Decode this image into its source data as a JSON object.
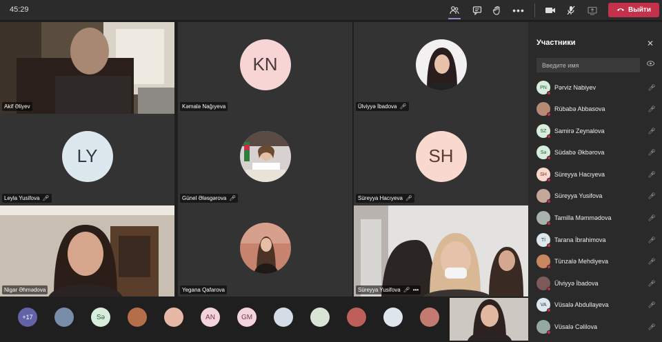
{
  "toolbar": {
    "timer": "45:29",
    "leave_label": "Выйти",
    "icons": [
      "people-icon",
      "chat-icon",
      "raise-hand-icon",
      "more-icon",
      "camera-icon",
      "mic-off-icon",
      "share-icon",
      "phone-icon"
    ]
  },
  "tiles": [
    {
      "name": "Akif Əliyev",
      "type": "video",
      "muted": false
    },
    {
      "name": "Kəmalə Nağıyeva",
      "type": "initials",
      "initials": "KN",
      "color": "#f6d5d4",
      "muted": false
    },
    {
      "name": "Ülviyyə İbadova",
      "type": "photo",
      "muted": true
    },
    {
      "name": "Leyla Yusifova",
      "type": "initials",
      "initials": "LY",
      "color": "#dde7ee",
      "muted": true
    },
    {
      "name": "Günel Ələsgərova",
      "type": "photo",
      "muted": true
    },
    {
      "name": "Süreyya Hacıyeva",
      "type": "initials",
      "initials": "SH",
      "color": "#f9d9ce",
      "muted": true
    },
    {
      "name": "Nigar Əhmədova",
      "type": "video",
      "muted": false
    },
    {
      "name": "Yegana Qafarova",
      "type": "photo",
      "muted": false
    },
    {
      "name": "Süreyya Yusifova",
      "type": "video",
      "muted": true
    }
  ],
  "strip": [
    {
      "label": "+17",
      "color": "#6264a7",
      "text_color": "#ffffff"
    },
    {
      "label": "",
      "color": "#7a8da8"
    },
    {
      "label": "Sə",
      "color": "#d8eedd"
    },
    {
      "label": "",
      "color": "#b46e4a"
    },
    {
      "label": "",
      "color": "#e8b8a6"
    },
    {
      "label": "AN",
      "color": "#f3d4dc"
    },
    {
      "label": "GM",
      "color": "#f3d4dc"
    },
    {
      "label": "",
      "color": "#d4dde5"
    },
    {
      "label": "",
      "color": "#d9e4d7"
    },
    {
      "label": "",
      "color": "#bb5f58"
    },
    {
      "label": "",
      "color": "#dfe5ec"
    },
    {
      "label": "",
      "color": "#c37a70"
    }
  ],
  "panel": {
    "title": "Участники",
    "search_placeholder": "Введите имя",
    "participants": [
      {
        "name": "Pərviz Nabiyev",
        "initials": "PN",
        "color": "#d8eedd"
      },
      {
        "name": "Rübabə Abbasova",
        "initials": "",
        "color": "#b78a75"
      },
      {
        "name": "Samirə Zeynalova",
        "initials": "SZ",
        "color": "#d8eedd"
      },
      {
        "name": "Südabə Əkbərova",
        "initials": "Sə",
        "color": "#d8eedd"
      },
      {
        "name": "Süreyya Hacıyeva",
        "initials": "SH",
        "color": "#f9d9ce"
      },
      {
        "name": "Süreyya Yusifova",
        "initials": "",
        "color": "#c5a79c"
      },
      {
        "name": "Tamilla Məmmədova",
        "initials": "",
        "color": "#a8b3ae"
      },
      {
        "name": "Tarana İbrahimova",
        "initials": "Tİ",
        "color": "#dde7ee"
      },
      {
        "name": "Tünzalə Mehdiyeva",
        "initials": "",
        "color": "#c9875f"
      },
      {
        "name": "Ülviyyə İbadova",
        "initials": "",
        "color": "#7c5a5a"
      },
      {
        "name": "Vüsalə Abdullayeva",
        "initials": "VA",
        "color": "#dde7ee"
      },
      {
        "name": "Vüsalə Cəlilova",
        "initials": "",
        "color": "#93a9a2"
      }
    ]
  }
}
